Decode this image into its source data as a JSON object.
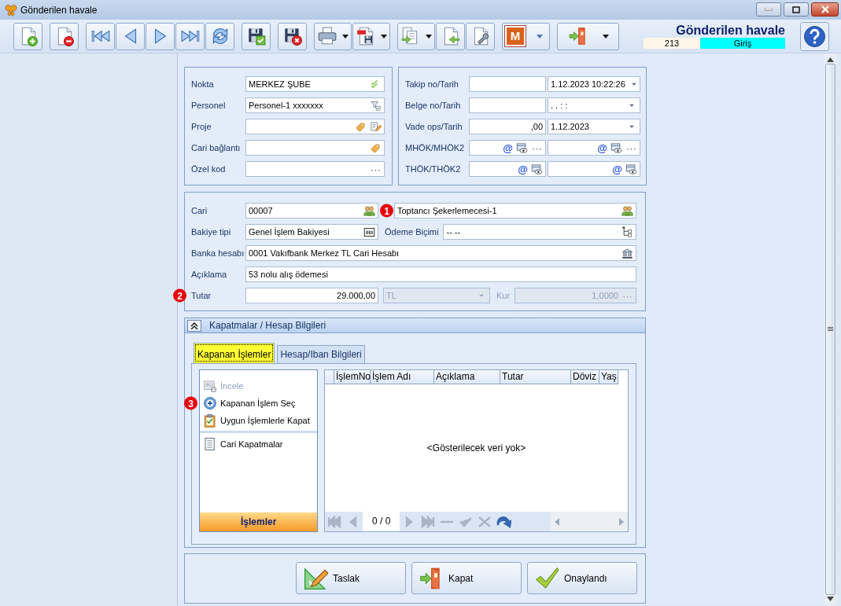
{
  "window": {
    "title": "Gönderilen havale"
  },
  "toolbar": [
    {
      "buttons": [
        {
          "kind": "doc-add",
          "dropdown": false
        }
      ]
    },
    {
      "buttons": [
        {
          "kind": "doc-remove",
          "dropdown": false
        }
      ]
    },
    {
      "buttons": [
        {
          "kind": "first",
          "dropdown": false
        },
        {
          "kind": "prev",
          "dropdown": false
        },
        {
          "kind": "next",
          "dropdown": false
        },
        {
          "kind": "last",
          "dropdown": false
        },
        {
          "kind": "refresh",
          "dropdown": false
        }
      ]
    },
    {
      "buttons": [
        {
          "kind": "save-ok",
          "dropdown": false
        }
      ]
    },
    {
      "buttons": [
        {
          "kind": "save-cancel",
          "dropdown": false
        }
      ]
    },
    {
      "buttons": [
        {
          "kind": "print",
          "dropdown": true
        },
        {
          "kind": "pdf",
          "dropdown": true
        }
      ]
    },
    {
      "buttons": [
        {
          "kind": "export",
          "dropdown": true
        },
        {
          "kind": "import",
          "dropdown": false
        },
        {
          "kind": "wrench",
          "dropdown": false
        }
      ]
    },
    {
      "buttons": [
        {
          "kind": "logo",
          "label": "M",
          "dropdown": true
        }
      ]
    },
    {
      "buttons": [
        {
          "kind": "exit",
          "dropdown": true
        }
      ]
    }
  ],
  "header": {
    "title": "Gönderilen havale",
    "record_no": "213",
    "mode": "Giriş"
  },
  "left_group": [
    {
      "label": "Nokta",
      "fields": [
        {
          "value": "MERKEZ ŞUBE",
          "buttons": [
            {
              "kind": "check"
            }
          ]
        }
      ]
    },
    {
      "label": "Personel",
      "fields": [
        {
          "value": "Personel-1 xxxxxxx",
          "buttons": [
            {
              "kind": "filter"
            }
          ]
        }
      ]
    },
    {
      "label": "Proje",
      "fields": [
        {
          "buttons": [
            {
              "kind": "tag"
            },
            {
              "kind": "edit"
            }
          ]
        }
      ]
    },
    {
      "label": "Cari bağlantı",
      "fields": [
        {
          "buttons": [
            {
              "kind": "tag"
            }
          ]
        }
      ]
    },
    {
      "label": "Özel kod",
      "fields": [
        {
          "buttons": [
            {
              "kind": "more"
            }
          ]
        }
      ]
    }
  ],
  "right_group": [
    {
      "label": "Takip no/Tarih",
      "fields": [
        {
          "kind": "field"
        },
        {
          "kind": "field",
          "value": "1.12.2023 10:22:26",
          "buttons": [
            {
              "kind": "dropdown"
            }
          ]
        }
      ]
    },
    {
      "label": "Belge no/Tarih",
      "fields": [
        {
          "kind": "field"
        },
        {
          "kind": "field",
          "value": " .  .       :  :",
          "buttons": [
            {
              "kind": "dropdown"
            }
          ]
        }
      ]
    },
    {
      "label": "Vade ops/Tarih",
      "fields": [
        {
          "kind": "number-field",
          "value": ",00"
        },
        {
          "kind": "field",
          "value": "1.12.2023",
          "buttons": [
            {
              "kind": "dropdown"
            }
          ]
        }
      ]
    },
    {
      "label": "MHÖK/MHÖK2",
      "fields": [
        {
          "buttons": [
            {
              "kind": "at",
              "text": "@"
            },
            {
              "kind": "view"
            },
            {
              "kind": "more"
            }
          ]
        },
        {
          "buttons": [
            {
              "kind": "at",
              "text": "@"
            },
            {
              "kind": "view"
            },
            {
              "kind": "more"
            }
          ]
        }
      ]
    },
    {
      "label": "THÖK/THÖK2",
      "fields": [
        {
          "buttons": [
            {
              "kind": "at",
              "text": "@"
            },
            {
              "kind": "view"
            }
          ]
        },
        {
          "buttons": [
            {
              "kind": "at",
              "text": "@"
            },
            {
              "kind": "view"
            }
          ]
        }
      ]
    }
  ],
  "main_group": [
    {
      "items": [
        {
          "kind": "label",
          "text": "Cari"
        },
        {
          "kind": "field",
          "value": "00007",
          "buttons": [
            {
              "kind": "people"
            }
          ]
        },
        {
          "kind": "field",
          "value": "Toptancı Şekerlemecesi-1",
          "marker": "1",
          "buttons": [
            {
              "kind": "people"
            }
          ]
        }
      ]
    },
    {
      "items": [
        {
          "kind": "label",
          "text": "Bakiye tipi"
        },
        {
          "kind": "field",
          "value": "Genel İşlem Bakiyesi",
          "buttons": [
            {
              "kind": "calc"
            }
          ]
        },
        {
          "kind": "label",
          "text": "Ödeme Biçimi"
        },
        {
          "kind": "field",
          "value": "-- --",
          "buttons": [
            {
              "kind": "tree"
            }
          ]
        }
      ]
    },
    {
      "items": [
        {
          "kind": "label",
          "text": "Banka hesabı"
        },
        {
          "kind": "field",
          "value": "0001 Vakıfbank Merkez TL Cari Hesabı",
          "buttons": [
            {
              "kind": "bank"
            }
          ]
        }
      ]
    },
    {
      "items": [
        {
          "kind": "label",
          "text": "Açıklama"
        },
        {
          "kind": "field",
          "value": "53 nolu alış ödemesi"
        }
      ]
    },
    {
      "items": [
        {
          "kind": "label",
          "text": "Tutar",
          "marker": "2"
        },
        {
          "kind": "number-field",
          "value": "29.000,00"
        },
        {
          "kind": "field",
          "value": "TL",
          "disabled": true,
          "buttons": [
            {
              "kind": "dropdown"
            }
          ]
        },
        {
          "kind": "label",
          "text": "Kur",
          "disabled": true
        },
        {
          "kind": "number-field",
          "value": "1,0000",
          "disabled": true,
          "buttons": [
            {
              "kind": "more"
            }
          ]
        }
      ]
    }
  ],
  "panel": {
    "title": "Kapatmalar / Hesap Bilgileri",
    "expanded": true,
    "tabs": [
      {
        "label": "Kapanan İşlemler",
        "selected": true
      },
      {
        "label": "Hesap/Iban Bilgileri",
        "selected": false
      }
    ],
    "actions": [
      [
        {
          "kind": "inspect",
          "text": "İncele",
          "disabled": true
        },
        {
          "kind": "add",
          "text": "Kapanan İşlem Seç",
          "disabled": false,
          "marker": "3"
        },
        {
          "kind": "clipboard",
          "text": "Uygun İşlemlerle Kapat",
          "disabled": false
        }
      ],
      [
        {
          "kind": "doc",
          "text": "Cari Kapatmalar",
          "disabled": false
        }
      ]
    ],
    "actions_footer": "İşlemler",
    "table": {
      "columns": [
        "İşlemNo",
        "İşlem Adı",
        "Açıklama",
        "Tutar",
        "Döviz",
        "Yaş"
      ],
      "empty_text": "<Gösterilecek veri yok>",
      "navigator": "0 / 0"
    }
  },
  "buttons": [
    {
      "kind": "draft",
      "text": "Taslak"
    },
    {
      "kind": "exit",
      "text": "Kapat"
    },
    {
      "kind": "approve",
      "text": "Onaylandı"
    }
  ]
}
